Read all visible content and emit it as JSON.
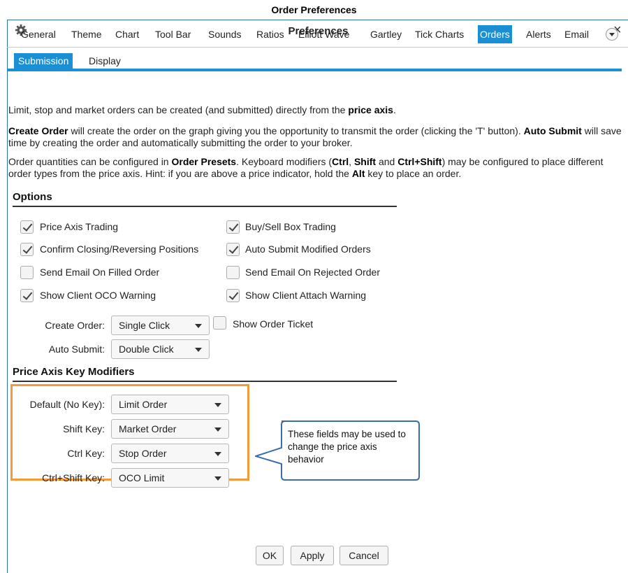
{
  "doc_title": "Order Preferences",
  "window": {
    "title": "Preferences",
    "gear_icon": "gear-icon",
    "close_label": "×"
  },
  "tabs": [
    {
      "label": "General"
    },
    {
      "label": "Theme"
    },
    {
      "label": "Chart"
    },
    {
      "label": "Tool Bar"
    },
    {
      "label": "Sounds"
    },
    {
      "label": "Ratios"
    },
    {
      "label": "Elliott Wave"
    },
    {
      "label": "Gartley"
    },
    {
      "label": "Tick Charts"
    },
    {
      "label": "Orders",
      "active": true
    },
    {
      "label": "Alerts"
    },
    {
      "label": "Email"
    }
  ],
  "subtabs": [
    {
      "label": "Submission",
      "active": true
    },
    {
      "label": "Display"
    }
  ],
  "paragraphs": {
    "p1": {
      "t1": "Limit, stop and market orders can be created (and submitted) directly from the ",
      "b1": "price axis",
      "t2": "."
    },
    "p2": {
      "b1": "Create Order",
      "t1": " will create the order on the graph giving you the opportunity to transmit the order (clicking the 'T' button).  ",
      "b2": "Auto Submit",
      "t2": " will save time by creating the order and automatically submitting the order to your broker."
    },
    "p3": {
      "t1": "Order quantities can be configured in ",
      "b1": "Order Presets",
      "t2": ".  Keyboard modifiers (",
      "b2": "Ctrl",
      "t3": ", ",
      "b3": "Shift",
      "t4": " and ",
      "b4": "Ctrl+Shift",
      "t5": ") may be configured to place different order types from the price axis.  Hint: if you are above a price indicator, hold the ",
      "b5": "Alt",
      "t6": " key to place an order."
    }
  },
  "options": {
    "heading": "Options",
    "checkboxes": [
      {
        "label": "Price Axis Trading",
        "checked": true
      },
      {
        "label": "Buy/Sell Box Trading",
        "checked": true
      },
      {
        "label": "Confirm Closing/Reversing Positions",
        "checked": true
      },
      {
        "label": "Auto Submit Modified Orders",
        "checked": true
      },
      {
        "label": "Send Email On Filled Order",
        "checked": false
      },
      {
        "label": "Send Email On Rejected Order",
        "checked": false
      },
      {
        "label": "Show Client OCO Warning",
        "checked": true
      },
      {
        "label": "Show Client Attach Warning",
        "checked": true
      }
    ],
    "create_order": {
      "label": "Create Order:",
      "value": "Single Click"
    },
    "show_order_ticket": {
      "label": "Show Order Ticket",
      "checked": false
    },
    "auto_submit": {
      "label": "Auto Submit:",
      "value": "Double Click"
    }
  },
  "key_modifiers": {
    "heading": "Price Axis Key Modifiers",
    "rows": [
      {
        "label": "Default (No Key):",
        "value": "Limit Order"
      },
      {
        "label": "Shift Key:",
        "value": "Market Order"
      },
      {
        "label": "Ctrl Key:",
        "value": "Stop Order"
      },
      {
        "label": "Ctrl+Shift Key:",
        "value": "OCO Limit"
      }
    ]
  },
  "callout": {
    "text": "These fields may be used to change the price axis behavior"
  },
  "buttons": {
    "ok": "OK",
    "apply": "Apply",
    "cancel": "Cancel"
  },
  "colors": {
    "accent": "#1b8fd3",
    "highlight_box": "#f59a38",
    "callout_border": "#3b6ea8"
  }
}
